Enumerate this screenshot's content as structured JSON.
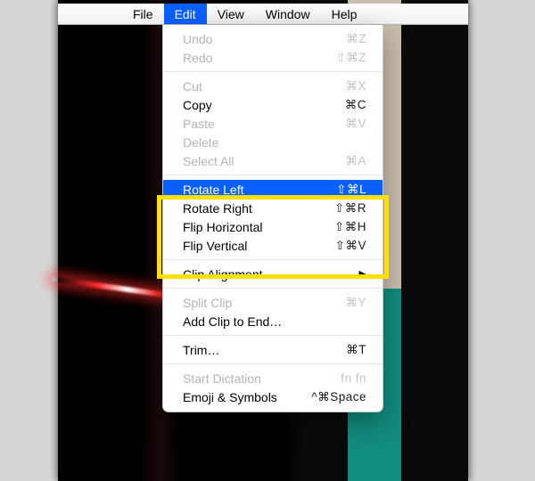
{
  "menubar": {
    "items": [
      {
        "label": "File",
        "active": false
      },
      {
        "label": "Edit",
        "active": true
      },
      {
        "label": "View",
        "active": false
      },
      {
        "label": "Window",
        "active": false
      },
      {
        "label": "Help",
        "active": false
      }
    ]
  },
  "dropdown": {
    "groups": [
      [
        {
          "label": "Undo",
          "shortcut": "⌘Z",
          "enabled": false
        },
        {
          "label": "Redo",
          "shortcut": "⇧⌘Z",
          "enabled": false
        }
      ],
      [
        {
          "label": "Cut",
          "shortcut": "⌘X",
          "enabled": false
        },
        {
          "label": "Copy",
          "shortcut": "⌘C",
          "enabled": true
        },
        {
          "label": "Paste",
          "shortcut": "⌘V",
          "enabled": false
        },
        {
          "label": "Delete",
          "shortcut": "",
          "enabled": false
        },
        {
          "label": "Select All",
          "shortcut": "⌘A",
          "enabled": false
        }
      ],
      [
        {
          "label": "Rotate Left",
          "shortcut": "⇧⌘L",
          "enabled": true,
          "highlight": true
        },
        {
          "label": "Rotate Right",
          "shortcut": "⇧⌘R",
          "enabled": true
        },
        {
          "label": "Flip Horizontal",
          "shortcut": "⇧⌘H",
          "enabled": true
        },
        {
          "label": "Flip Vertical",
          "shortcut": "⇧⌘V",
          "enabled": true
        }
      ],
      [
        {
          "label": "Clip Alignment",
          "shortcut": "",
          "enabled": true,
          "submenu": true
        }
      ],
      [
        {
          "label": "Split Clip",
          "shortcut": "⌘Y",
          "enabled": false
        },
        {
          "label": "Add Clip to End…",
          "shortcut": "",
          "enabled": true
        }
      ],
      [
        {
          "label": "Trim…",
          "shortcut": "⌘T",
          "enabled": true
        }
      ],
      [
        {
          "label": "Start Dictation",
          "shortcut": "fn fn",
          "enabled": false
        },
        {
          "label": "Emoji & Symbols",
          "shortcut": "^⌘Space",
          "enabled": true
        }
      ]
    ]
  },
  "annotation": {
    "purpose": "highlight transform commands group"
  }
}
